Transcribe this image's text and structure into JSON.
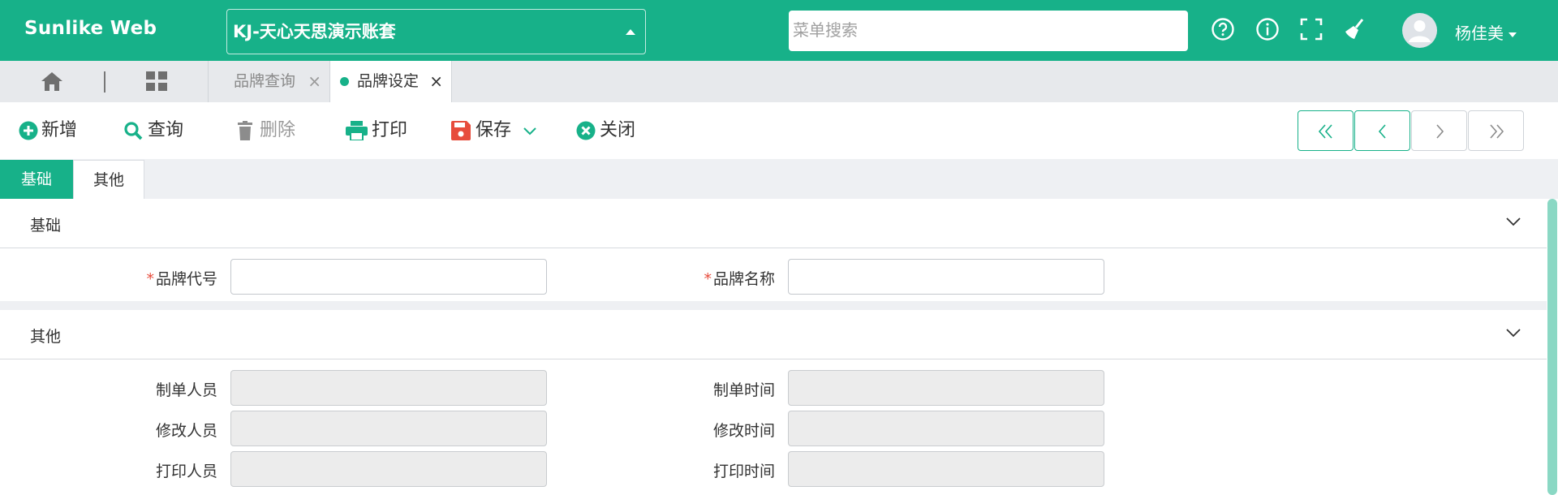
{
  "app": {
    "brand": "Sunlike Web",
    "account": "KJ-天心天思演示账套",
    "search_placeholder": "菜单搜索",
    "user": "杨佳美"
  },
  "tabs": [
    {
      "label": "品牌查询",
      "active": false
    },
    {
      "label": "品牌设定",
      "active": true
    }
  ],
  "toolbar": {
    "new_label": "新增",
    "query_label": "查询",
    "delete_label": "删除",
    "print_label": "打印",
    "save_label": "保存",
    "close_label": "关闭"
  },
  "subtabs": [
    "基础",
    "其他"
  ],
  "sections": {
    "basic": {
      "title": "基础",
      "brand_code_label": "品牌代号",
      "brand_code_value": "",
      "brand_name_label": "品牌名称",
      "brand_name_value": ""
    },
    "other": {
      "title": "其他",
      "creator_label": "制单人员",
      "create_time_label": "制单时间",
      "modifier_label": "修改人员",
      "modify_time_label": "修改时间",
      "printer_label": "打印人员",
      "print_time_label": "打印时间"
    }
  },
  "colors": {
    "accent": "#17b189",
    "required": "#e74c3c",
    "danger": "#e74c3c"
  },
  "icons": [
    "help-icon",
    "info-icon",
    "fullscreen-icon",
    "clean-icon",
    "home-icon",
    "grid-icon",
    "plus-circle-icon",
    "search-icon",
    "trash-icon",
    "printer-icon",
    "save-icon",
    "close-circle-icon",
    "chevron-down-icon"
  ]
}
